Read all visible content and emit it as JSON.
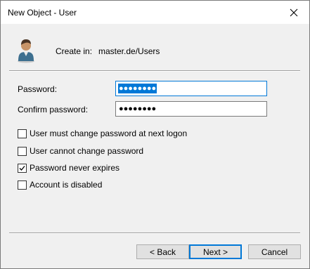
{
  "window": {
    "title": "New Object - User"
  },
  "header": {
    "create_in_label": "Create in:",
    "create_in_value": "master.de/Users"
  },
  "fields": {
    "password_label": "Password:",
    "password_value": "●●●●●●●●",
    "confirm_label": "Confirm password:",
    "confirm_value": "●●●●●●●●"
  },
  "options": [
    {
      "label": "User must change password at next logon",
      "checked": false
    },
    {
      "label": "User cannot change password",
      "checked": false
    },
    {
      "label": "Password never expires",
      "checked": true
    },
    {
      "label": "Account is disabled",
      "checked": false
    }
  ],
  "buttons": {
    "back": "< Back",
    "next": "Next >",
    "cancel": "Cancel"
  },
  "colors": {
    "accent": "#0078d7",
    "dialog_bg": "#f0f0f0"
  },
  "icons": {
    "close": "close-icon",
    "user": "user-icon",
    "check": "checkmark-icon"
  }
}
